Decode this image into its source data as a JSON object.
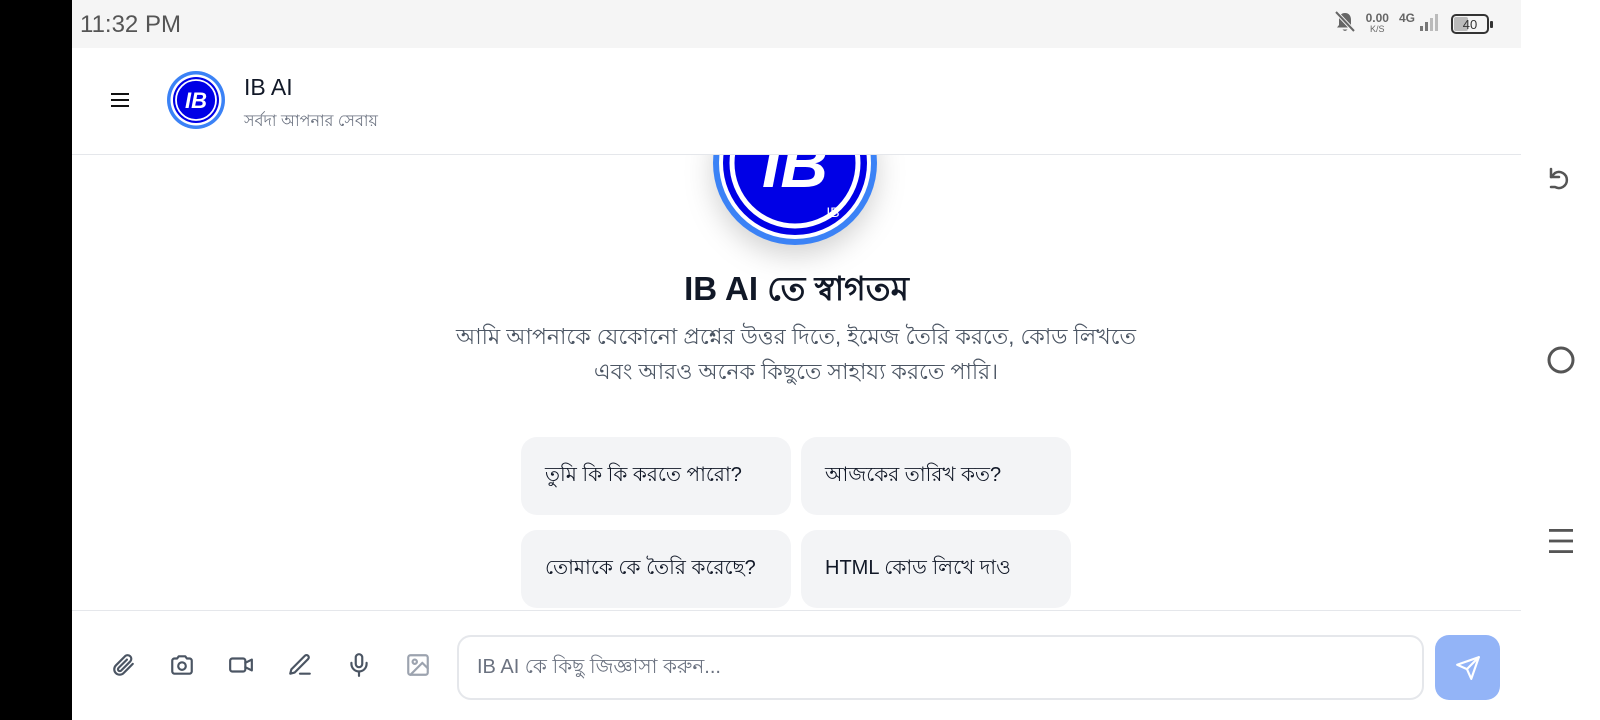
{
  "status_bar": {
    "time": "11:32 PM",
    "net_speed_value": "0.00",
    "net_speed_unit": "K/S",
    "network_type": "4G",
    "battery_level": "40",
    "battery_fraction": 0.4
  },
  "header": {
    "title": "IB AI",
    "subtitle": "সর্বদা আপনার সেবায়",
    "logo_text": "IB"
  },
  "welcome": {
    "title": "IB AI তে স্বাগতম",
    "description": "আমি আপনাকে যেকোনো প্রশ্নের উত্তর দিতে, ইমেজ তৈরি করতে, কোড লিখতে এবং আরও অনেক কিছুতে সাহায্য করতে পারি।"
  },
  "suggestions": [
    "তুমি কি কি করতে পারো?",
    "আজকের তারিখ কত?",
    "তোমাকে কে তৈরি করেছে?",
    "HTML কোড লিখে দাও"
  ],
  "input": {
    "placeholder": "IB AI কে কিছু জিজ্ঞাসা করুন...",
    "value": ""
  },
  "toolbar_icons": [
    "attach-icon",
    "camera-icon",
    "video-icon",
    "pen-icon",
    "microphone-icon",
    "image-icon"
  ],
  "colors": {
    "brand_blue": "#0000e6",
    "ring_blue": "#3b82f6",
    "send_button": "#93b4f7",
    "chip_background": "#f3f4f6"
  }
}
